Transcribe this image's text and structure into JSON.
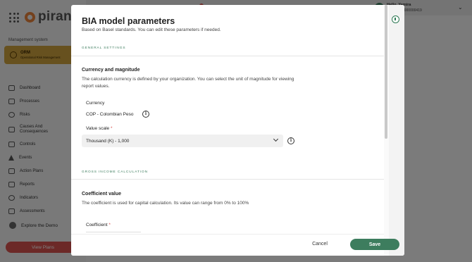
{
  "app": {
    "logo_text": "piran",
    "management_label": "Management system",
    "module": {
      "title": "ORM",
      "subtitle": "Operational Risk Management"
    },
    "nav": [
      {
        "label": "Dashboard",
        "icon": "dashboard-icon"
      },
      {
        "label": "Processes",
        "icon": "processes-icon"
      },
      {
        "label": "Risks",
        "icon": "risks-icon"
      },
      {
        "label": "Causes And Consequences",
        "icon": "causes-icon"
      },
      {
        "label": "Controls",
        "icon": "controls-icon"
      },
      {
        "label": "Events",
        "icon": "events-icon"
      },
      {
        "label": "Action Plans",
        "icon": "action-plans-icon"
      },
      {
        "label": "Reports",
        "icon": "reports-icon"
      },
      {
        "label": "Indicators",
        "icon": "indicators-icon"
      },
      {
        "label": "Assessments",
        "icon": "assessments-icon"
      }
    ],
    "explore_label": "Explore the Demo",
    "view_plans_label": "View Plans",
    "user": {
      "name": "Hello, Yamira",
      "id_text": "emo - ID: 0000000419"
    }
  },
  "modal": {
    "title": "BIA model parameters",
    "subtitle": "Based on Basel standards. You can edit these parameters if needed.",
    "general_settings_label": "GENERAL SETTINGS",
    "currency_block": {
      "title": "Currency and magnitude",
      "description": "The calculation currency is defined by your organization. You can select the unit of magnitude for viewing report values.",
      "currency_label": "Currency",
      "currency_value": "COP - Colombian Peso",
      "value_scale_label": "Value scale",
      "required_mark": "*",
      "value_scale_selected": "Thousand (K) - 1,000"
    },
    "gross_income_label": "GROSS INCOME CALCULATION",
    "coefficient_block": {
      "title": "Coefficient value",
      "description": "The coefficient is used for capital calculation. Its value can range from 0% to 100%",
      "coefficient_label": "Coefficient",
      "required_mark": "*"
    },
    "cancel_label": "Cancel",
    "save_label": "Save",
    "info_glyph": "i"
  },
  "colors": {
    "accent": "#3d7d5e",
    "orm_card": "#cfa33e",
    "view_plans": "#d9534f",
    "logo": "#e8823a"
  }
}
